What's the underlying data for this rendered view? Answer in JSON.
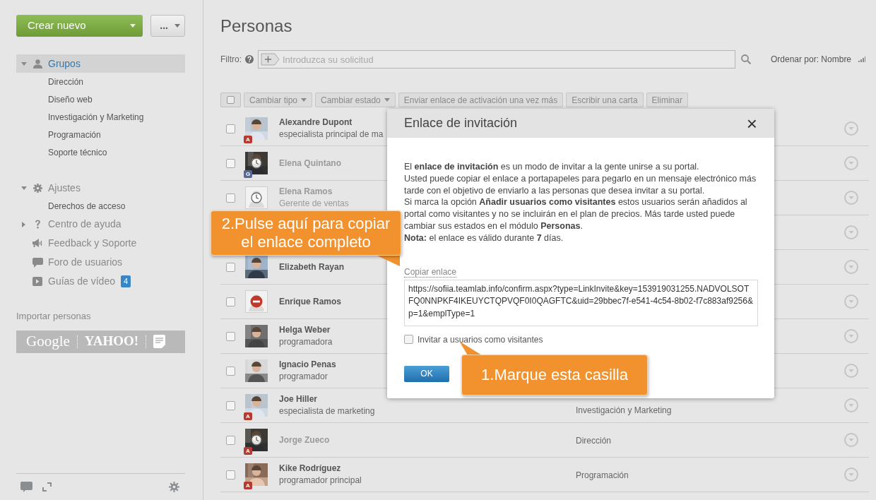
{
  "sidebar": {
    "create_button": "Crear nuevo",
    "more_button": "...",
    "sections": [
      {
        "label": "Grupos",
        "expanded": true,
        "selected": true,
        "children": [
          {
            "label": "Dirección"
          },
          {
            "label": "Diseño web"
          },
          {
            "label": "Investigación y Marketing"
          },
          {
            "label": "Programación"
          },
          {
            "label": "Soporte técnico"
          }
        ]
      },
      {
        "label": "Ajustes",
        "expanded": true,
        "selected": false,
        "children": [
          {
            "label": "Derechos de acceso"
          }
        ]
      },
      {
        "label": "Centro de ayuda",
        "expanded": false,
        "selected": false
      },
      {
        "label": "Feedback y Soporte",
        "selected": false
      },
      {
        "label": "Foro de usuarios",
        "selected": false
      },
      {
        "label": "Guías de vídeo",
        "selected": false,
        "badge": "4"
      }
    ],
    "import": {
      "title": "Importar personas",
      "services": [
        "Google",
        "YAHOO!"
      ]
    }
  },
  "main": {
    "title": "Personas",
    "filter": {
      "label": "Filtro:",
      "placeholder": "Introduzca su solicitud"
    },
    "sort": "Ordenar por: Nombre",
    "select_all": {
      "checked": false
    },
    "toolbar": [
      {
        "label": "Cambiar tipo",
        "dropdown": true
      },
      {
        "label": "Cambiar estado",
        "dropdown": true
      },
      {
        "label": "Enviar enlace de activación una vez más",
        "dropdown": false
      },
      {
        "label": "Escribir una carta",
        "dropdown": false
      },
      {
        "label": "Eliminar",
        "dropdown": false
      }
    ],
    "rows": [
      {
        "kind": "person",
        "name": "Alexandre Dupont",
        "title": "especialista principal de ma",
        "pending": false,
        "blocked": false,
        "photo": true,
        "badge": {
          "text": "A",
          "color": "#b63a2f"
        },
        "checked": false
      },
      {
        "kind": "person",
        "name": "Elena Quintano",
        "pending": true,
        "blocked": false,
        "photo": true,
        "badge": {
          "text": "G",
          "color": "#56679a"
        },
        "checked": false
      },
      {
        "kind": "person",
        "name": "Elena Ramos",
        "title": "Gerente de ventas",
        "pending": true,
        "blocked": false,
        "photo": false,
        "checked": false
      },
      {
        "kind": "covered"
      },
      {
        "kind": "person",
        "name": "Elizabeth Rayan",
        "pending": false,
        "blocked": false,
        "photo": true,
        "checked": false
      },
      {
        "kind": "person",
        "name": "Enrique Ramos",
        "pending": false,
        "blocked": true,
        "photo": false,
        "checked": false
      },
      {
        "kind": "person",
        "name": "Helga Weber",
        "title": "programadora",
        "pending": false,
        "blocked": false,
        "photo": true,
        "checked": false
      },
      {
        "kind": "person",
        "name": "Ignacio Penas",
        "title": "programador",
        "pending": false,
        "blocked": false,
        "photo": true,
        "checked": false
      },
      {
        "kind": "person",
        "name": "Joe Hiller",
        "title": "especialista de marketing",
        "department": "Investigación y Marketing",
        "pending": false,
        "blocked": false,
        "photo": true,
        "badge": {
          "text": "A",
          "color": "#b63a2f"
        },
        "checked": false
      },
      {
        "kind": "person",
        "name": "Jorge Zueco",
        "department": "Dirección",
        "pending": true,
        "blocked": false,
        "photo": true,
        "badge": {
          "text": "A",
          "color": "#b63a2f"
        },
        "checked": false
      },
      {
        "kind": "person",
        "name": "Kike Rodríguez",
        "title": "programador principal",
        "department": "Programación",
        "pending": false,
        "blocked": false,
        "photo": true,
        "badge": {
          "text": "A",
          "color": "#b63a2f"
        },
        "checked": false
      }
    ]
  },
  "dialog": {
    "title": "Enlace de invitación",
    "close": "×",
    "paragraphs": [
      "El **enlace de invitación** es un modo de invitar a la gente unirse a su portal.",
      "Usted puede copiar el enlace a portapapeles para pegarlo en un mensaje electrónico más tarde con el objetivo de enviarlo a las personas que desea invitar a su portal.",
      "Si marca la opción **Añadir usuarios como visitantes** estos usuarios serán añadidos al portal como visitantes y no se incluirán en el plan de precios. Más tarde usted puede cambiar sus estados en el módulo **Personas**.",
      "**Nota:** el enlace es válido durante **7** días."
    ],
    "copy_link": "Copiar enlace",
    "link": "https://sofiia.teamlab.info/confirm.aspx?type=LinkInvite&key=153919031255.NADVOLSOTFQ0NNPKF4IKEUYCTQPVQF0I0QAGFTC&uid=29bbec7f-e541-4c54-8b02-f7c883af9256&p=1&emplType=1",
    "checkbox": {
      "label": "Invitar a usuarios como visitantes",
      "checked": false
    },
    "ok_button": "OK"
  },
  "callouts": [
    {
      "text": "2.Pulse aquí para copiar el enlace completo",
      "kind": "copy"
    },
    {
      "text": "1.Marque esta casilla",
      "kind": "checkbox"
    }
  ]
}
